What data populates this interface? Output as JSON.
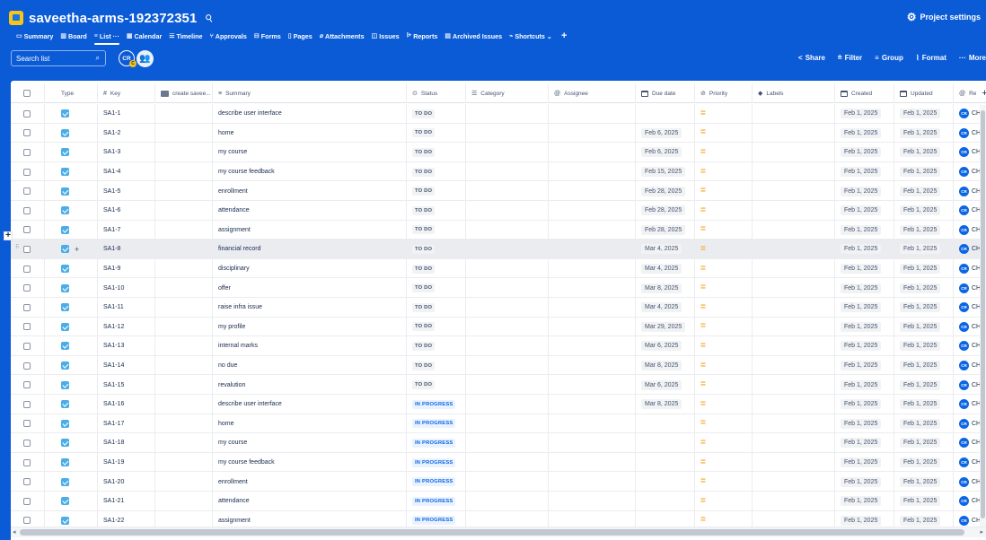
{
  "project": {
    "title": "saveetha-arms-192372351",
    "settings_label": "Project settings"
  },
  "tabs": [
    {
      "icon": "▭",
      "label": "Summary"
    },
    {
      "icon": "▥",
      "label": "Board"
    },
    {
      "icon": "≡",
      "label": "List ···",
      "active": true
    },
    {
      "icon": "▦",
      "label": "Calendar"
    },
    {
      "icon": "☰",
      "label": "Timeline"
    },
    {
      "icon": "⑂",
      "label": "Approvals"
    },
    {
      "icon": "⊟",
      "label": "Forms"
    },
    {
      "icon": "▯",
      "label": "Pages"
    },
    {
      "icon": "⌀",
      "label": "Attachments"
    },
    {
      "icon": "◫",
      "label": "Issues"
    },
    {
      "icon": "⩥",
      "label": "Reports"
    },
    {
      "icon": "▤",
      "label": "Archived Issues"
    },
    {
      "icon": "⌁",
      "label": "Shortcuts ⌄"
    }
  ],
  "toolbar": {
    "search_placeholder": "Search list",
    "avatar_initials": "CR",
    "avatar_badge": "C",
    "share": "Share",
    "filter": "Filter",
    "group": "Group",
    "format": "Format",
    "more": "More"
  },
  "columns": {
    "type": "Type",
    "key": "Key",
    "create": "create savee...",
    "summary": "Summary",
    "status": "Status",
    "category": "Category",
    "assignee": "Assignee",
    "due": "Due date",
    "priority": "Priority",
    "labels": "Labels",
    "created": "Created",
    "updated": "Updated",
    "reporter": "Re"
  },
  "rows": [
    {
      "key": "SA1-1",
      "summary": "describe user interface",
      "status": "TO DO",
      "due": "",
      "created": "Feb 1, 2025",
      "updated": "Feb 1, 2025",
      "reporter_initials": "CR",
      "reporter": "CH"
    },
    {
      "key": "SA1-2",
      "summary": "home",
      "status": "TO DO",
      "due": "Feb 6, 2025",
      "created": "Feb 1, 2025",
      "updated": "Feb 1, 2025",
      "reporter_initials": "CR",
      "reporter": "CH"
    },
    {
      "key": "SA1-3",
      "summary": "my course",
      "status": "TO DO",
      "due": "Feb 6, 2025",
      "created": "Feb 1, 2025",
      "updated": "Feb 1, 2025",
      "reporter_initials": "CR",
      "reporter": "CH"
    },
    {
      "key": "SA1-4",
      "summary": "my course feedback",
      "status": "TO DO",
      "due": "Feb 15, 2025",
      "created": "Feb 1, 2025",
      "updated": "Feb 1, 2025",
      "reporter_initials": "CR",
      "reporter": "CH"
    },
    {
      "key": "SA1-5",
      "summary": "enrollment",
      "status": "TO DO",
      "due": "Feb 28, 2025",
      "created": "Feb 1, 2025",
      "updated": "Feb 1, 2025",
      "reporter_initials": "CR",
      "reporter": "CH"
    },
    {
      "key": "SA1-6",
      "summary": "attendance",
      "status": "TO DO",
      "due": "Feb 28, 2025",
      "created": "Feb 1, 2025",
      "updated": "Feb 1, 2025",
      "reporter_initials": "CR",
      "reporter": "CH"
    },
    {
      "key": "SA1-7",
      "summary": "assignment",
      "status": "TO DO",
      "due": "Feb 28, 2025",
      "created": "Feb 1, 2025",
      "updated": "Feb 1, 2025",
      "reporter_initials": "CR",
      "reporter": "CH"
    },
    {
      "key": "SA1-8",
      "summary": "financial record",
      "status": "TO DO",
      "due": "Mar 4, 2025",
      "created": "Feb 1, 2025",
      "updated": "Feb 1, 2025",
      "reporter_initials": "CR",
      "reporter": "CH",
      "highlight": true
    },
    {
      "key": "SA1-9",
      "summary": "disciplinary",
      "status": "TO DO",
      "due": "Mar 4, 2025",
      "created": "Feb 1, 2025",
      "updated": "Feb 1, 2025",
      "reporter_initials": "CR",
      "reporter": "CH"
    },
    {
      "key": "SA1-10",
      "summary": "offer",
      "status": "TO DO",
      "due": "Mar 8, 2025",
      "created": "Feb 1, 2025",
      "updated": "Feb 1, 2025",
      "reporter_initials": "CR",
      "reporter": "CH"
    },
    {
      "key": "SA1-11",
      "summary": "raise infra issue",
      "status": "TO DO",
      "due": "Mar 4, 2025",
      "created": "Feb 1, 2025",
      "updated": "Feb 1, 2025",
      "reporter_initials": "CR",
      "reporter": "CH"
    },
    {
      "key": "SA1-12",
      "summary": "my profile",
      "status": "TO DO",
      "due": "Mar 29, 2025",
      "created": "Feb 1, 2025",
      "updated": "Feb 1, 2025",
      "reporter_initials": "CR",
      "reporter": "CH"
    },
    {
      "key": "SA1-13",
      "summary": "internal marks",
      "status": "TO DO",
      "due": "Mar 6, 2025",
      "created": "Feb 1, 2025",
      "updated": "Feb 1, 2025",
      "reporter_initials": "CR",
      "reporter": "CH"
    },
    {
      "key": "SA1-14",
      "summary": "no due",
      "status": "TO DO",
      "due": "Mar 8, 2025",
      "created": "Feb 1, 2025",
      "updated": "Feb 1, 2025",
      "reporter_initials": "CR",
      "reporter": "CH"
    },
    {
      "key": "SA1-15",
      "summary": "revalution",
      "status": "TO DO",
      "due": "Mar 6, 2025",
      "created": "Feb 1, 2025",
      "updated": "Feb 1, 2025",
      "reporter_initials": "CR",
      "reporter": "CH"
    },
    {
      "key": "SA1-16",
      "summary": "describe user interface",
      "status": "IN PROGRESS",
      "due": "Mar 8, 2025",
      "created": "Feb 1, 2025",
      "updated": "Feb 1, 2025",
      "reporter_initials": "CR",
      "reporter": "CH"
    },
    {
      "key": "SA1-17",
      "summary": "home",
      "status": "IN PROGRESS",
      "due": "",
      "created": "Feb 1, 2025",
      "updated": "Feb 1, 2025",
      "reporter_initials": "CR",
      "reporter": "CH"
    },
    {
      "key": "SA1-18",
      "summary": "my course",
      "status": "IN PROGRESS",
      "due": "",
      "created": "Feb 1, 2025",
      "updated": "Feb 1, 2025",
      "reporter_initials": "CR",
      "reporter": "CH"
    },
    {
      "key": "SA1-19",
      "summary": "my course feedback",
      "status": "IN PROGRESS",
      "due": "",
      "created": "Feb 1, 2025",
      "updated": "Feb 1, 2025",
      "reporter_initials": "CR",
      "reporter": "CH"
    },
    {
      "key": "SA1-20",
      "summary": "enrollment",
      "status": "IN PROGRESS",
      "due": "",
      "created": "Feb 1, 2025",
      "updated": "Feb 1, 2025",
      "reporter_initials": "CR",
      "reporter": "CH"
    },
    {
      "key": "SA1-21",
      "summary": "attendance",
      "status": "IN PROGRESS",
      "due": "",
      "created": "Feb 1, 2025",
      "updated": "Feb 1, 2025",
      "reporter_initials": "CR",
      "reporter": "CH"
    },
    {
      "key": "SA1-22",
      "summary": "assignment",
      "status": "IN PROGRESS",
      "due": "",
      "created": "Feb 1, 2025",
      "updated": "Feb 1, 2025",
      "reporter_initials": "CR",
      "reporter": "CH"
    }
  ],
  "colors": {
    "brand": "#0b5bd7",
    "todo": "#44546f",
    "in_progress": "#0c66e4",
    "priority_medium": "#f5a623"
  }
}
